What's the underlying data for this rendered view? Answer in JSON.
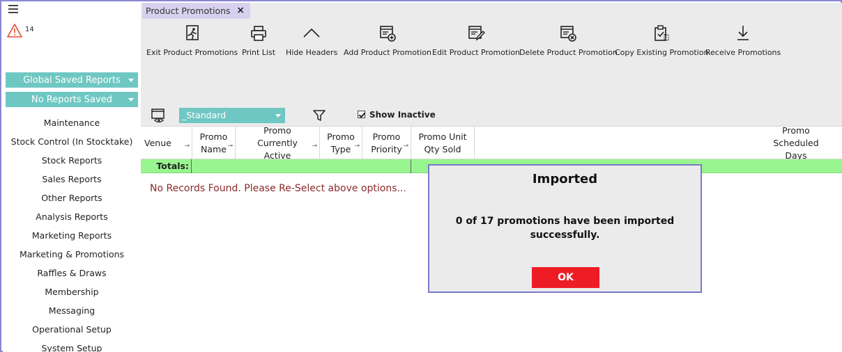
{
  "sidebar": {
    "alert_count": "14",
    "global_reports": "Global Saved Reports",
    "saved_reports": "No Reports Saved",
    "items": [
      "Maintenance",
      "Stock Control (In Stocktake)",
      "Stock Reports",
      "Sales Reports",
      "Other Reports",
      "Analysis Reports",
      "Marketing Reports",
      "Marketing & Promotions",
      "Raffles & Draws",
      "Membership",
      "Messaging",
      "Operational Setup",
      "System Setup"
    ]
  },
  "tab": {
    "label": "Product Promotions",
    "close": "×"
  },
  "toolbar": {
    "exit": "Exit Product Promotions",
    "print": "Print List",
    "hide": "Hide Headers",
    "add": "Add Product Promotion",
    "edit": "Edit Product Promotion",
    "delete": "Delete Product Promotion",
    "copy": "Copy Existing Promotion",
    "receive": "Receive Promotions"
  },
  "filters": {
    "layout": "_Standard",
    "show_inactive": "Show Inactive"
  },
  "grid": {
    "columns": [
      "Venue",
      "Promo Name",
      "Promo Currently Active",
      "Promo Type",
      "Promo Priority",
      "Promo Unit Qty Sold",
      "Promo Scheduled Days"
    ],
    "totals_label": "Totals:",
    "empty_message": "No Records Found. Please Re-Select above options..."
  },
  "dialog": {
    "title": "Imported",
    "message": "0 of 17 promotions have been imported successfully.",
    "ok": "OK"
  },
  "colors": {
    "accent_teal": "#6fc7c3",
    "tab_lilac": "#d7d1ef",
    "totals_green": "#99f58f",
    "ok_red": "#ee1c25",
    "frame_border": "#8a87d6",
    "empty_text": "#8b2a2a"
  }
}
